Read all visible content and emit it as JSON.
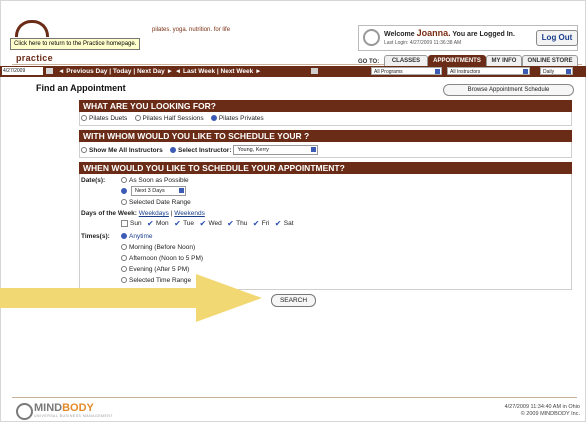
{
  "header": {
    "tagline": "pilates. yoga. nutrition. for life",
    "tooltip": "Click here to return to the Practice homepage.",
    "brand": "practice",
    "welcome_prefix": "Welcome",
    "user_name": "Joanna.",
    "welcome_suffix": "You are Logged In.",
    "last_login": "Last Login: 4/27/2009 11:36:38 AM",
    "logout_label": "Log Out",
    "goto_label": "GO TO:",
    "tabs": [
      "CLASSES",
      "APPOINTMENTS",
      "MY INFO",
      "ONLINE STORE"
    ],
    "active_tab": "APPOINTMENTS"
  },
  "navbar": {
    "date": "4/27/2009",
    "links": "◄ Previous Day | Today | Next Day ► ◄ Last Week | Next Week ►",
    "program_select": "All Programs",
    "instructor_select": "All Instructors",
    "view_select": "Daily"
  },
  "main": {
    "title": "Find an Appointment",
    "browse_label": "Browse Appointment Schedule",
    "section1": {
      "heading": "WHAT ARE YOU LOOKING FOR?",
      "options": [
        "Pilates Duets",
        "Pilates Half Sessions",
        "Pilates Privates"
      ],
      "selected": "Pilates Privates"
    },
    "section2": {
      "heading": "WITH WHOM WOULD YOU LIKE TO SCHEDULE YOUR   ?",
      "option_all": "Show Me All Instructors",
      "option_select": "Select Instructor:",
      "instructor_value": "Young, Kerry"
    },
    "section3": {
      "heading": "WHEN WOULD YOU LIKE TO SCHEDULE YOUR APPOINTMENT?",
      "dates_label": "Date(s):",
      "date_asap": "As Soon as Possible",
      "date_next_value": "Next 3 Days",
      "date_range": "Selected Date Range",
      "days_label": "Days of the Week:",
      "weekdays_link": "Weekdays",
      "weekends_link": "Weekends",
      "days": [
        "Sun",
        "Mon",
        "Tue",
        "Wed",
        "Thu",
        "Fri",
        "Sat"
      ],
      "times_label": "Times(s):",
      "times": [
        "Anytime",
        "Morning (Before Noon)",
        "Afternoon (Noon to 5 PM)",
        "Evening (After 5 PM)",
        "Selected Time Range"
      ]
    },
    "search_label": "SEARCH"
  },
  "footer": {
    "logo_a": "MIND",
    "logo_b": "BODY",
    "logo_sub": "UNIVERSAL BUSINESS MANAGEMENT",
    "timestamp": "4/27/2009 11:34:40 AM in Ohio",
    "copyright": "© 2009 MINDBODY Inc."
  },
  "colors": {
    "brand_brown": "#6a2c17",
    "accent_blue": "#3b5bb5",
    "highlight_arrow": "#f2d873"
  }
}
